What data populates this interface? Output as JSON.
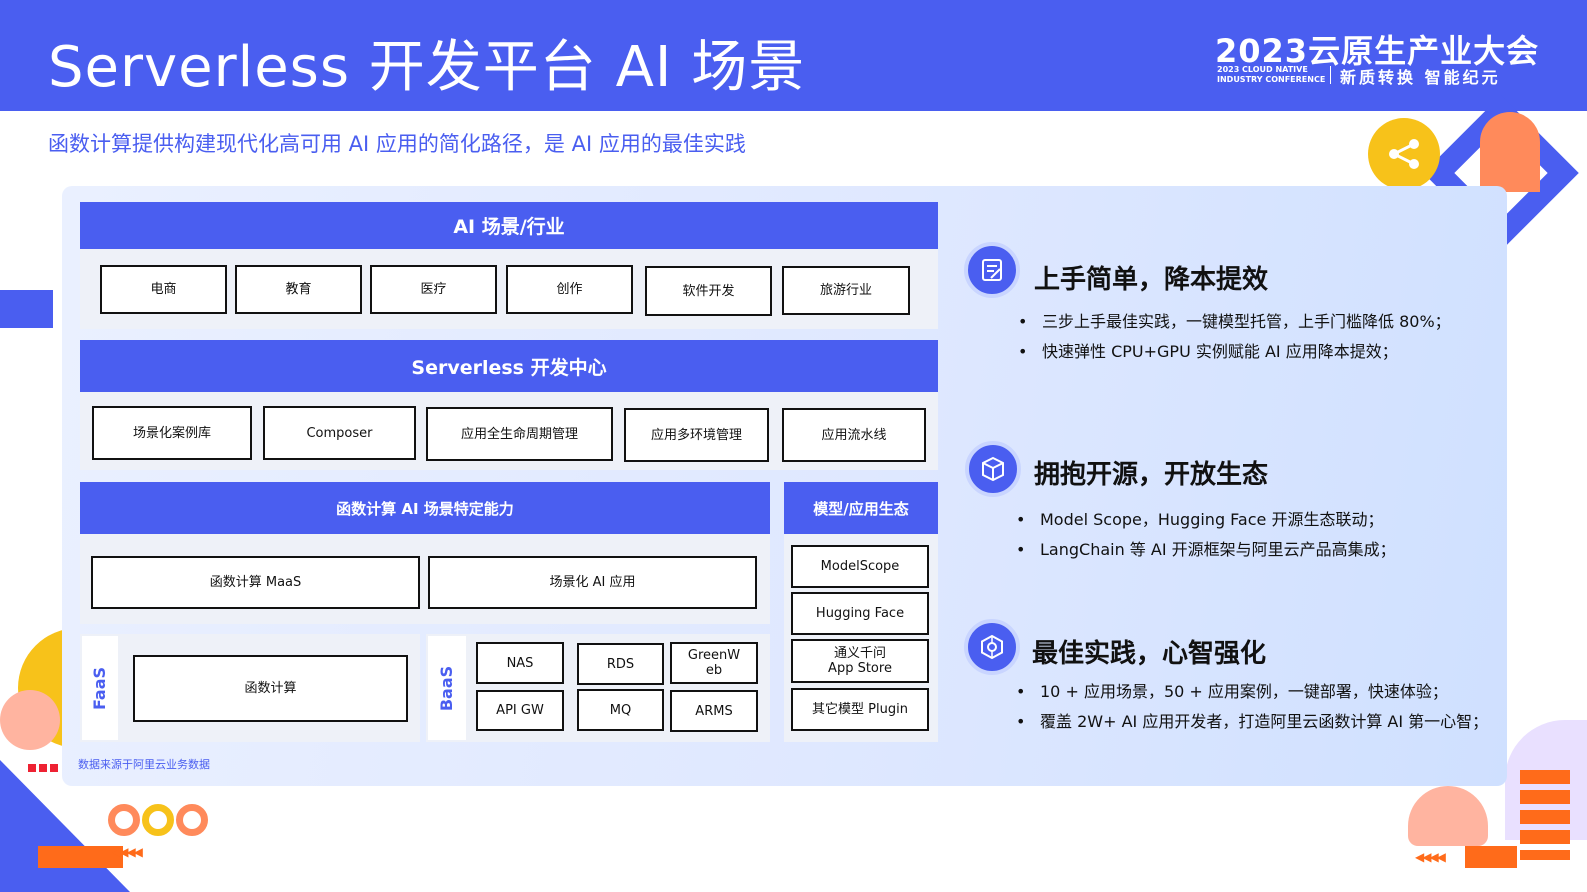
{
  "header": {
    "title": "Serverless 开发平台 AI 场景",
    "conference_year": "2023云原生产业大会",
    "conference_en_line1": "2023 CLOUD NATIVE",
    "conference_en_line2": "INDUSTRY CONFERENCE",
    "conference_slogan": "新质转换 智能纪元"
  },
  "subtitle": "函数计算提供构建现代化高可用 AI 应用的简化路径，是 AI 应用的最佳实践",
  "diagram": {
    "industry": {
      "title": "AI 场景/行业",
      "items": [
        "电商",
        "教育",
        "医疗",
        "创作",
        "软件开发",
        "旅游行业"
      ]
    },
    "dev_center": {
      "title": "Serverless 开发中心",
      "items": [
        "场景化案例库",
        "Composer",
        "应用全生命周期管理",
        "应用多环境管理",
        "应用流水线"
      ]
    },
    "capability": {
      "title": "函数计算 AI 场景特定能力",
      "items": [
        "函数计算 MaaS",
        "场景化 AI 应用"
      ]
    },
    "faas": {
      "label": "FaaS",
      "item": "函数计算"
    },
    "baas": {
      "label": "BaaS",
      "items": [
        "NAS",
        "RDS",
        "GreenW\neb",
        "API GW",
        "MQ",
        "ARMS"
      ]
    },
    "ecosystem": {
      "title": "模型/应用生态",
      "items": [
        "ModelScope",
        "Hugging Face",
        "通义千问\nApp Store",
        "其它模型 Plugin"
      ]
    },
    "note": "数据来源于阿里云业务数据"
  },
  "features": [
    {
      "icon": "document-edit-icon",
      "title": "上手简单，降本提效",
      "bullets": [
        "三步上手最佳实践，一键模型托管，上手门槛降低 80%；",
        "快速弹性 CPU+GPU 实例赋能 AI 应用降本提效；"
      ]
    },
    {
      "icon": "cube-icon",
      "title": "拥抱开源，开放生态",
      "bullets": [
        "Model Scope，Hugging Face 开源生态联动；",
        "LangChain 等 AI 开源框架与阿里云产品高集成；"
      ]
    },
    {
      "icon": "hexagon-network-icon",
      "title": "最佳实践，心智强化",
      "bullets": [
        "10 + 应用场景，50 + 应用案例，一键部署，快速体验；",
        "覆盖 2W+ AI 应用开发者，打造阿里云函数计算 AI 第一心智；"
      ]
    }
  ],
  "colors": {
    "primary": "#4a5ef0",
    "accent_orange": "#ff6b1a",
    "accent_yellow": "#f7c21a"
  }
}
